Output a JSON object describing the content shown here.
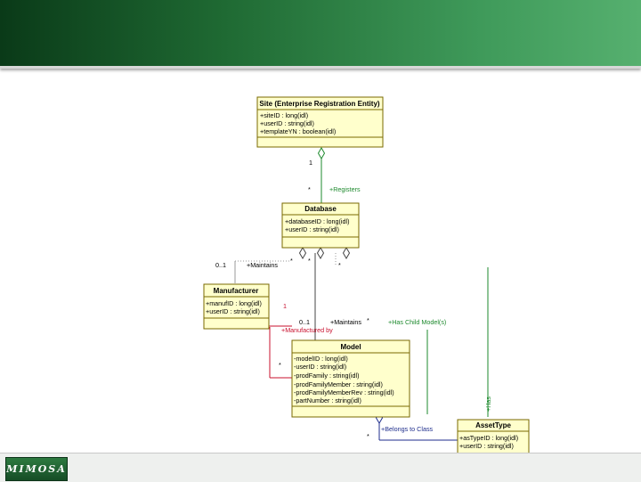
{
  "logo_text": "MIMOSA",
  "classes": {
    "site": {
      "name": "Site (Enterprise Registration Entity)",
      "attributes": [
        "+siteID : long(idl)",
        "+userID : string(idl)",
        "+templateYN : boolean(idl)"
      ]
    },
    "database": {
      "name": "Database",
      "attributes": [
        "+databaseID : long(idl)",
        "+userID : string(idl)"
      ]
    },
    "manufacturer": {
      "name": "Manufacturer",
      "attributes": [
        "+manufID : long(idl)",
        "+userID : string(idl)"
      ]
    },
    "model": {
      "name": "Model",
      "attributes": [
        "-modelID : long(idl)",
        "-userID : string(idl)",
        "-prodFamily : string(idl)",
        "-prodFamilyMember : string(idl)",
        "-prodFamilyMemberRev : string(idl)",
        "-partNumber : string(idl)"
      ]
    },
    "assettype": {
      "name": "AssetType",
      "attributes": [
        "+asTypeID : long(idl)",
        "+userID : string(idl)"
      ]
    }
  },
  "labels": {
    "site_mult": "1",
    "db_mult": "*",
    "registers": "+Registers",
    "mfr_mult": "0..1",
    "maintains1": "+Maintains",
    "db_star1": "*",
    "db_star2": "*",
    "db_star3": "*",
    "mfr_one": "1",
    "model_mult": "0..1",
    "maintains2": "+Maintains",
    "maintains2_star": "*",
    "has_child": "+Has Child Model(s)",
    "manufactured_by": "+Manufactured by",
    "model_star": "*",
    "belongs_to": "+Belongs to Class",
    "assettype_star": "*",
    "vertical_label": "+Has"
  }
}
